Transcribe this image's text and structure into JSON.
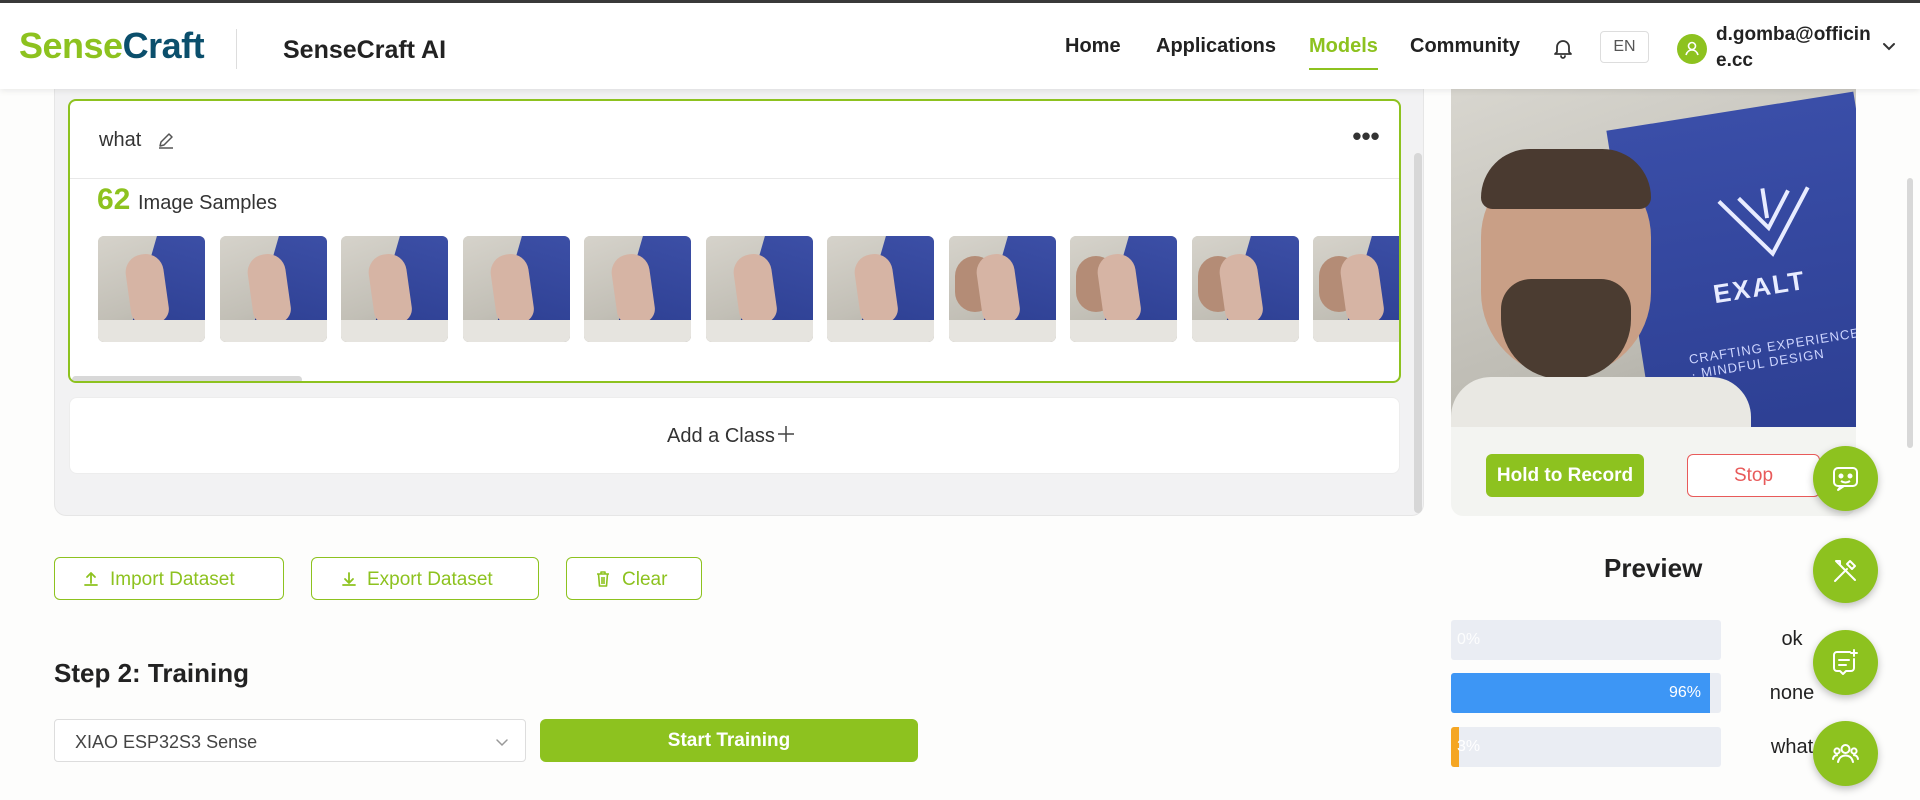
{
  "header": {
    "logo_prefix": "Sense",
    "logo_suffix": "Craft",
    "app_name": "SenseCraft AI",
    "nav": [
      "Home",
      "Applications",
      "Models",
      "Community"
    ],
    "active_nav": "Models",
    "lang": "EN",
    "user": "d.gomba@officine.cc"
  },
  "class_card": {
    "name": "what",
    "sample_count": "62",
    "sample_label": "Image Samples"
  },
  "add_class": {
    "label": "Add a Class"
  },
  "dataset": {
    "import_label": "Import Dataset",
    "export_label": "Export Dataset",
    "clear_label": "Clear"
  },
  "training": {
    "title": "Step 2: Training",
    "device": "XIAO ESP32S3 Sense",
    "start_label": "Start Training"
  },
  "camera": {
    "banner_text": "EXALT",
    "banner_sub": "CRAFTING EXPERIENCES · MINDFUL DESIGN",
    "hold_label": "Hold to Record",
    "stop_label": "Stop"
  },
  "preview": {
    "title": "Preview",
    "results": [
      {
        "label": "ok",
        "percent": 0,
        "percent_text": "0%",
        "color": "#3d96f5"
      },
      {
        "label": "none",
        "percent": 96,
        "percent_text": "96%",
        "color": "#3d96f5"
      },
      {
        "label": "what",
        "percent": 3,
        "percent_text": "3%",
        "color": "#f5a623"
      }
    ]
  },
  "colors": {
    "accent": "#8dc21f",
    "brand_dark": "#0b4f6c",
    "danger": "#e85a5a",
    "bar_blue": "#3d96f5",
    "bar_orange": "#f5a623"
  },
  "fabs": [
    "chat-bot-icon",
    "tools-icon",
    "feedback-icon",
    "community-icon"
  ]
}
